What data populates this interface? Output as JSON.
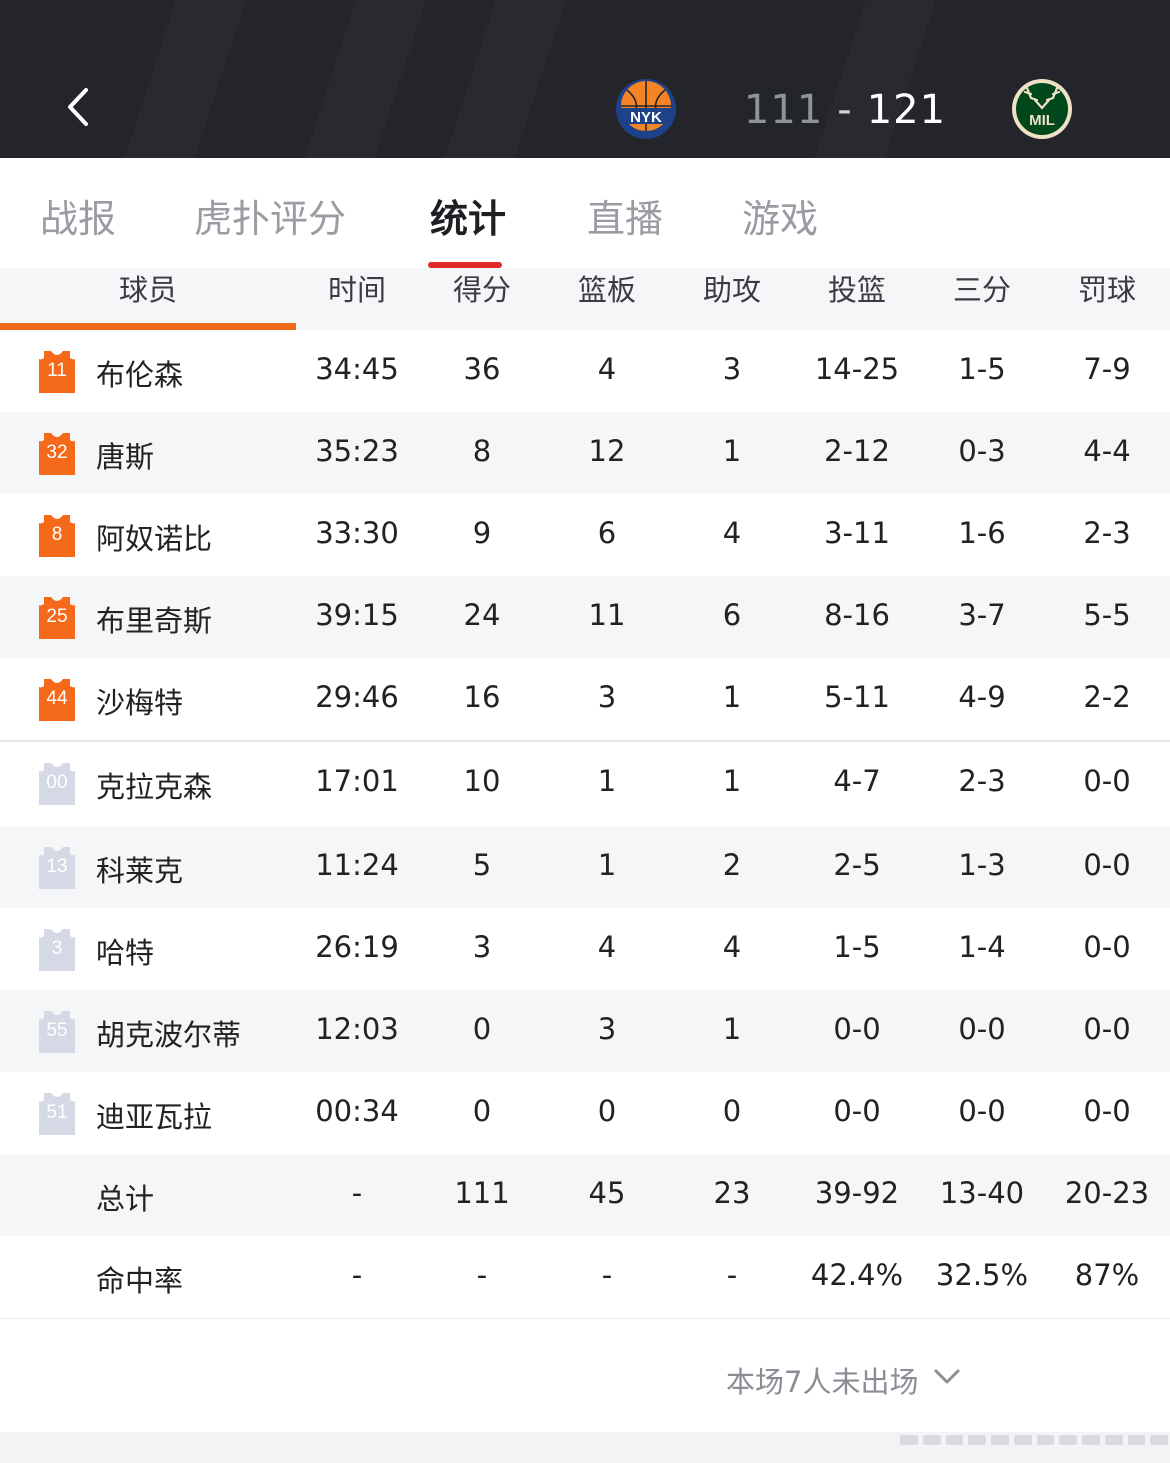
{
  "header": {
    "back_icon": "chevron-left-icon",
    "home_team": {
      "abbr": "NYK",
      "color": "#f58426"
    },
    "away_team": {
      "abbr": "MIL",
      "color": "#00471b"
    },
    "score": {
      "home": "111",
      "separator": "-",
      "away": "121"
    }
  },
  "tabs": [
    {
      "label": "战报",
      "active": false
    },
    {
      "label": "虎扑评分",
      "active": false
    },
    {
      "label": "统计",
      "active": true
    },
    {
      "label": "直播",
      "active": false
    },
    {
      "label": "游戏",
      "active": false
    }
  ],
  "table": {
    "columns": [
      "球员",
      "时间",
      "得分",
      "篮板",
      "助攻",
      "投篮",
      "三分",
      "罚球"
    ],
    "starters": [
      {
        "number": "11",
        "name": "布伦森",
        "min": "34:45",
        "pts": "36",
        "reb": "4",
        "ast": "3",
        "fg": "14-25",
        "three": "1-5",
        "ft": "7-9"
      },
      {
        "number": "32",
        "name": "唐斯",
        "min": "35:23",
        "pts": "8",
        "reb": "12",
        "ast": "1",
        "fg": "2-12",
        "three": "0-3",
        "ft": "4-4"
      },
      {
        "number": "8",
        "name": "阿奴诺比",
        "min": "33:30",
        "pts": "9",
        "reb": "6",
        "ast": "4",
        "fg": "3-11",
        "three": "1-6",
        "ft": "2-3"
      },
      {
        "number": "25",
        "name": "布里奇斯",
        "min": "39:15",
        "pts": "24",
        "reb": "11",
        "ast": "6",
        "fg": "8-16",
        "three": "3-7",
        "ft": "5-5"
      },
      {
        "number": "44",
        "name": "沙梅特",
        "min": "29:46",
        "pts": "16",
        "reb": "3",
        "ast": "1",
        "fg": "5-11",
        "three": "4-9",
        "ft": "2-2"
      }
    ],
    "bench": [
      {
        "number": "00",
        "name": "克拉克森",
        "min": "17:01",
        "pts": "10",
        "reb": "1",
        "ast": "1",
        "fg": "4-7",
        "three": "2-3",
        "ft": "0-0"
      },
      {
        "number": "13",
        "name": "科莱克",
        "min": "11:24",
        "pts": "5",
        "reb": "1",
        "ast": "2",
        "fg": "2-5",
        "three": "1-3",
        "ft": "0-0"
      },
      {
        "number": "3",
        "name": "哈特",
        "min": "26:19",
        "pts": "3",
        "reb": "4",
        "ast": "4",
        "fg": "1-5",
        "three": "1-4",
        "ft": "0-0"
      },
      {
        "number": "55",
        "name": "胡克波尔蒂",
        "min": "12:03",
        "pts": "0",
        "reb": "3",
        "ast": "1",
        "fg": "0-0",
        "three": "0-0",
        "ft": "0-0"
      },
      {
        "number": "51",
        "name": "迪亚瓦拉",
        "min": "00:34",
        "pts": "0",
        "reb": "0",
        "ast": "0",
        "fg": "0-0",
        "three": "0-0",
        "ft": "0-0"
      }
    ],
    "totals": {
      "name": "总计",
      "min": "-",
      "pts": "111",
      "reb": "45",
      "ast": "23",
      "fg": "39-92",
      "three": "13-40",
      "ft": "20-23"
    },
    "pct": {
      "name": "命中率",
      "min": "-",
      "pts": "-",
      "reb": "-",
      "ast": "-",
      "fg": "42.4%",
      "three": "32.5%",
      "ft": "87%"
    }
  },
  "footer": {
    "dnp_text": "本场7人未出场",
    "chevron_icon": "chevron-down-icon"
  },
  "colors": {
    "header_bg": "#23252a",
    "accent_orange": "#f06a1a",
    "tab_indicator": "#e02828",
    "starter_jersey": "#f5691a",
    "bench_jersey": "#d5d9e6"
  }
}
